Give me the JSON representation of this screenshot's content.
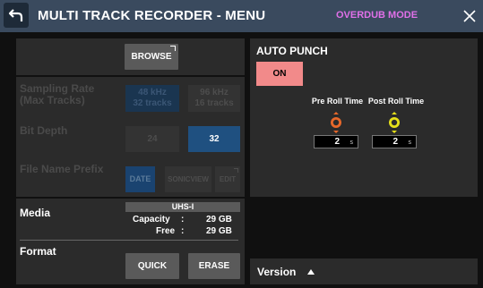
{
  "header": {
    "title": "MULTI TRACK RECORDER - MENU",
    "mode": "OVERDUB MODE"
  },
  "left": {
    "browse_label": "BROWSE",
    "sampling_rate": {
      "label_line1": "Sampling Rate",
      "label_line2": "(Max Tracks)",
      "opt1_line1": "48 kHz",
      "opt1_line2": "32 tracks",
      "opt2_line1": "96 kHz",
      "opt2_line2": "16 tracks"
    },
    "bit_depth": {
      "label": "Bit Depth",
      "opt1": "24",
      "opt2": "32"
    },
    "file_name_prefix": {
      "label": "File Name Prefix",
      "opt_date": "DATE",
      "opt_sonicview": "SONICVIEW",
      "opt_edit": "EDIT"
    },
    "media": {
      "label": "Media",
      "card_name": "UHS-I",
      "capacity_label": "Capacity",
      "capacity_sep": ":",
      "capacity_value": "29 GB",
      "free_label": "Free",
      "free_sep": ":",
      "free_value": "29 GB"
    },
    "format": {
      "label": "Format",
      "quick": "QUICK",
      "erase": "ERASE"
    }
  },
  "right": {
    "auto_punch": {
      "title": "AUTO PUNCH",
      "on_label": "ON",
      "pre_roll_label": "Pre Roll Time",
      "post_roll_label": "Post Roll Time",
      "pre_roll_value": "2",
      "post_roll_value": "2",
      "unit": "s"
    },
    "version_label": "Version"
  },
  "colors": {
    "header_bg": "#3a4a5e",
    "mode": "#e070e8",
    "on_button": "#f28a8a",
    "selected_blue": "#1f5080",
    "pre_knob": "#e8682a",
    "post_knob": "#e6e01a"
  }
}
